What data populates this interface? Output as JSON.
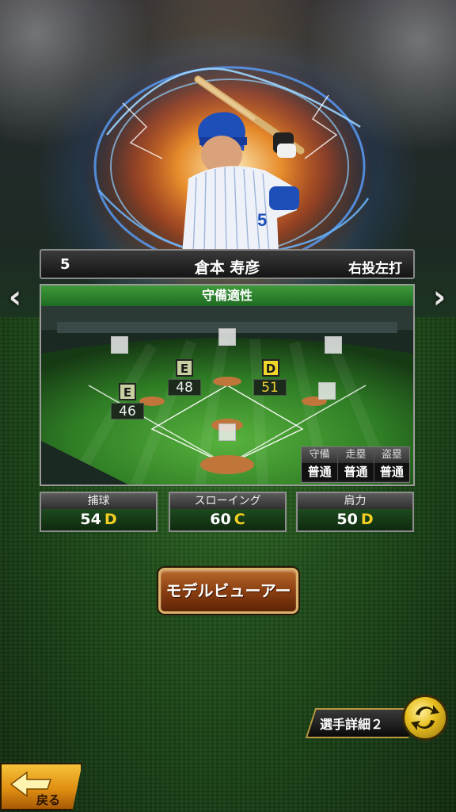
{
  "player": {
    "number": "5",
    "name": "倉本 寿彦",
    "handedness": "右投左打"
  },
  "nav": {
    "prev": "‹",
    "next": "›"
  },
  "fielding": {
    "title": "守備適性",
    "positions": [
      {
        "id": "second",
        "grade": "D",
        "value": "51"
      },
      {
        "id": "third",
        "grade": "E",
        "value": "46"
      },
      {
        "id": "short",
        "grade": "E",
        "value": "48"
      }
    ],
    "skills": {
      "headers": [
        "守備",
        "走塁",
        "盗塁"
      ],
      "values": [
        "普通",
        "普通",
        "普通"
      ]
    }
  },
  "stats": [
    {
      "label": "捕球",
      "value": "54",
      "grade": "D"
    },
    {
      "label": "スローイング",
      "value": "60",
      "grade": "C"
    },
    {
      "label": "肩力",
      "value": "50",
      "grade": "D"
    }
  ],
  "buttons": {
    "model_viewer": "モデルビューアー",
    "player_detail": "選手詳細２",
    "back": "戻る"
  },
  "colors": {
    "field_green": "#3f9a3a",
    "grade_d": "#f0d628",
    "grade_e": "#c8cfa0",
    "button_brown": "#8b3f12",
    "back_orange": "#e08f12"
  }
}
